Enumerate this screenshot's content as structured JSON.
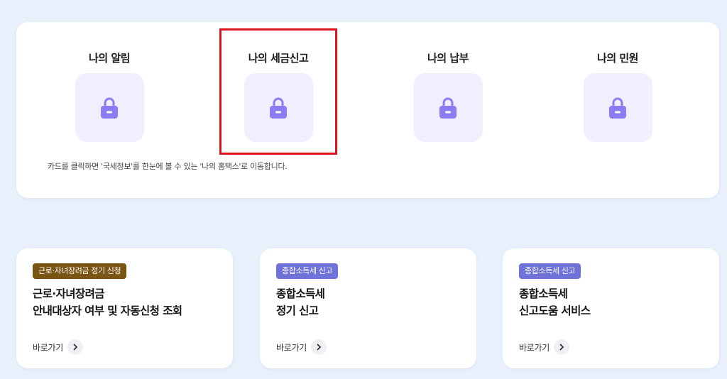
{
  "my_cards": [
    {
      "title": "나의 알림",
      "icon": "lock-icon"
    },
    {
      "title": "나의 세금신고",
      "icon": "lock-icon"
    },
    {
      "title": "나의 납부",
      "icon": "lock-icon"
    },
    {
      "title": "나의 민원",
      "icon": "lock-icon"
    }
  ],
  "notice": "카드를 클릭하면 '국세정보'를 한눈에 볼 수 있는 '나의 홈택스'로 이동합니다.",
  "services": [
    {
      "badge": "근로·자녀장려금 정기 신청",
      "badge_color": "#7a5412",
      "title_line1": "근로·자녀장려금",
      "title_line2": "안내대상자 여부 및 자동신청 조회",
      "link": "바로가기"
    },
    {
      "badge": "종합소득세 신고",
      "badge_color": "#6f72d9",
      "title_line1": "종합소득세",
      "title_line2": "정기 신고",
      "link": "바로가기"
    },
    {
      "badge": "종합소득세 신고",
      "badge_color": "#6f72d9",
      "title_line1": "종합소득세",
      "title_line2": "신고도움 서비스",
      "link": "바로가기"
    }
  ],
  "colors": {
    "background": "#e7f0fb",
    "lock_tile": "#f1efff",
    "lock_icon": "#8b7cf2",
    "highlight": "#e0141f"
  }
}
